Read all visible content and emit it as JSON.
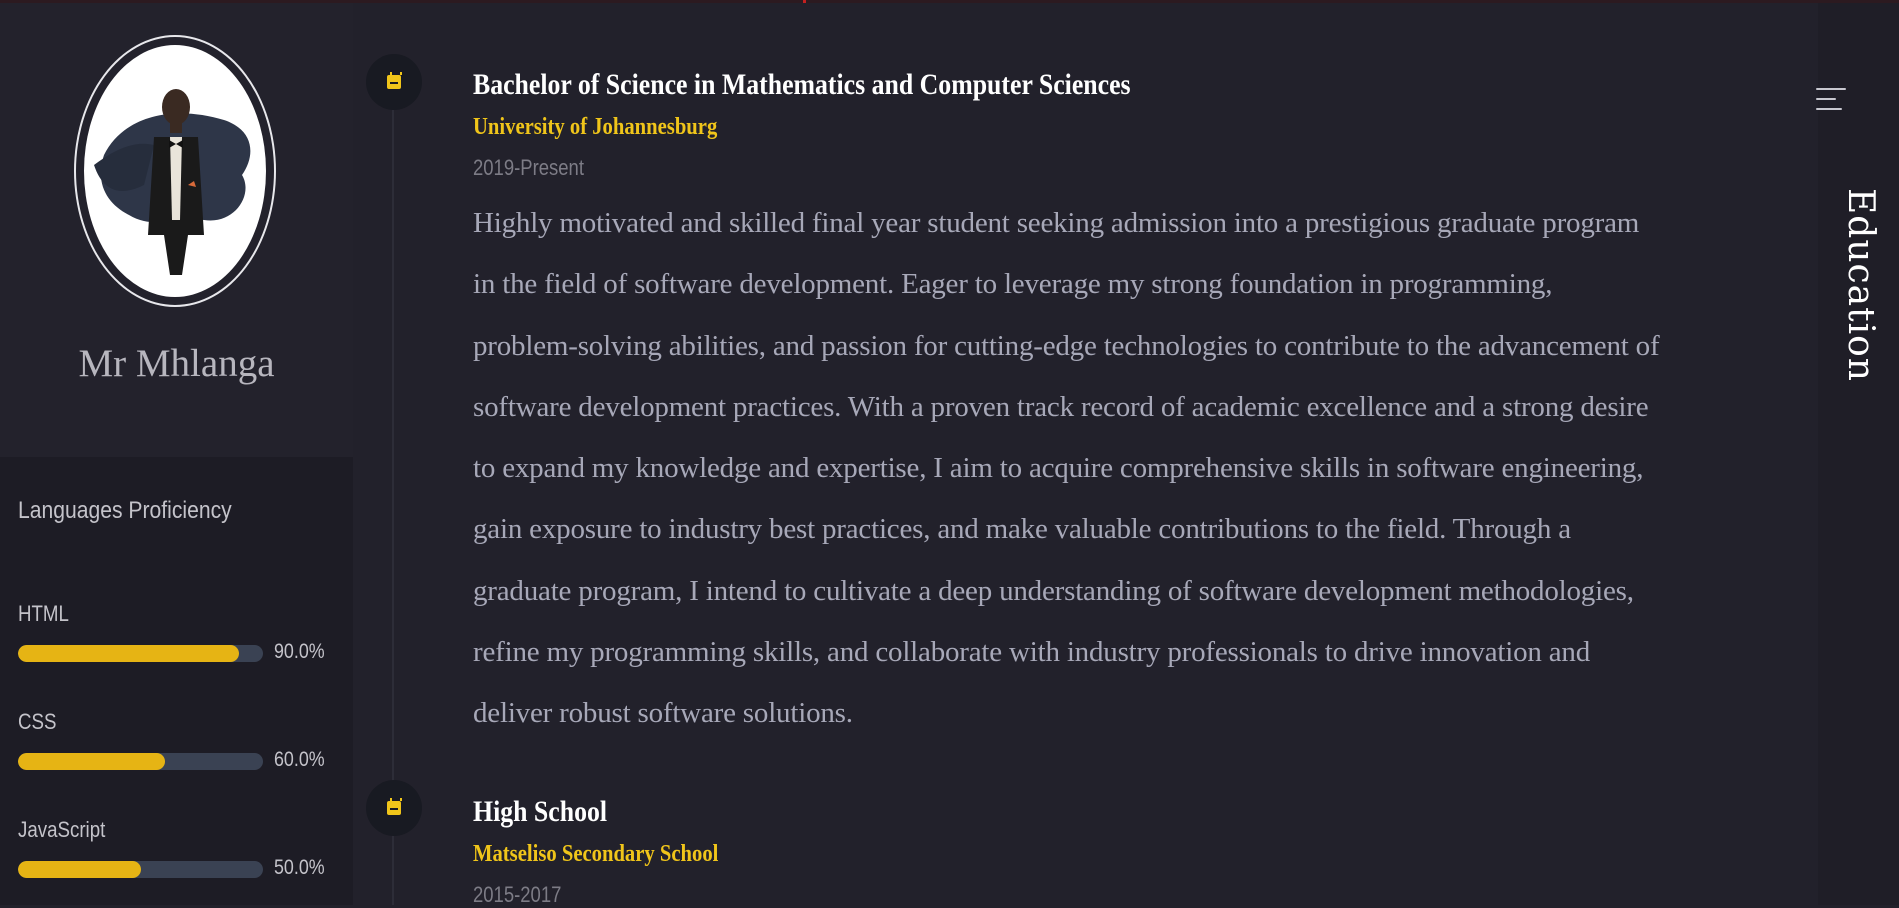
{
  "profile": {
    "name": "Mr Mhlanga",
    "avatar_icon": "profile-photo"
  },
  "languages": {
    "title": "Languages Proficiency",
    "items": [
      {
        "name": "HTML",
        "value_label": "90.0%",
        "fraction": 0.9
      },
      {
        "name": "CSS",
        "value_label": "60.0%",
        "fraction": 0.6
      },
      {
        "name": "JavaScript",
        "value_label": "50.0%",
        "fraction": 0.5
      }
    ]
  },
  "education": {
    "section_title": "Education",
    "entries": [
      {
        "degree": "Bachelor of Science in Mathematics and Computer Sciences",
        "institution": "University of Johannesburg",
        "period": "2019-Present",
        "description": "Highly motivated and skilled final year student seeking admission into a prestigious graduate program in the field of software development. Eager to leverage my strong foundation in programming, problem-solving abilities, and passion for cutting-edge technologies to contribute to the advancement of software development practices. With a proven track record of academic excellence and a strong desire to expand my knowledge and expertise, I aim to acquire comprehensive skills in software engineering, gain exposure to industry best practices, and make valuable contributions to the field. Through a graduate program, I intend to cultivate a deep understanding of software development methodologies, refine my programming skills, and collaborate with industry professionals to drive innovation and deliver robust software solutions."
      },
      {
        "degree": "High School",
        "institution": "Matseliso Secondary School",
        "period": "2015-2017"
      }
    ]
  },
  "icons": {
    "timeline": "calendar-icon",
    "menu": "menu-icon"
  },
  "colors": {
    "accent": "#f0c51a",
    "background": "#22212b",
    "sidebar": "#1d1c25",
    "track": "#3a4253"
  }
}
